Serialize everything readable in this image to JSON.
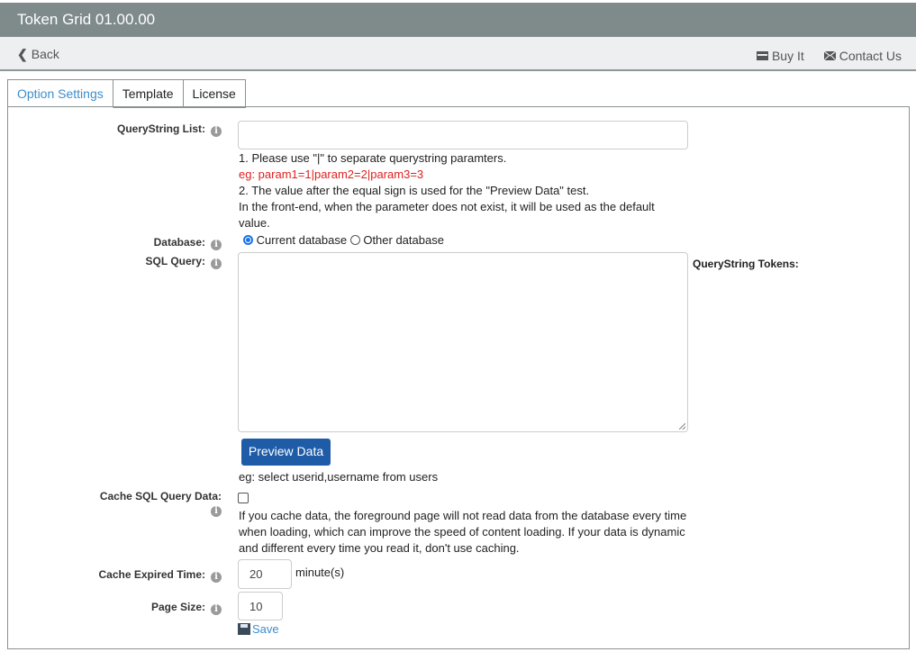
{
  "app": {
    "title": "Token Grid 01.00.00"
  },
  "nav": {
    "back_label": "Back",
    "buy_label": "Buy It",
    "contact_label": "Contact Us"
  },
  "tabs": [
    {
      "label": "Option Settings",
      "active": true
    },
    {
      "label": "Template",
      "active": false
    },
    {
      "label": "License",
      "active": false
    }
  ],
  "form": {
    "querystring": {
      "label": "QueryString List:",
      "value": "",
      "help1": "1. Please use \"|\" to separate querystring paramters.",
      "example": "eg: param1=1|param2=2|param3=3",
      "help2": "2. The value after the equal sign is used for the \"Preview Data\" test.",
      "help3": "In the front-end, when the parameter does not exist, it will be used as the default",
      "help4": "value."
    },
    "database": {
      "label": "Database:",
      "options": [
        "Current database",
        "Other database"
      ],
      "selected": "Current database"
    },
    "sql": {
      "label": "SQL Query:",
      "value": "",
      "tokens_label": "QueryString Tokens:",
      "preview_button": "Preview Data",
      "example": "eg: select userid,username from users"
    },
    "cache": {
      "label": "Cache SQL Query Data:",
      "checked": false,
      "help1": "If you cache data, the foreground page will not read data from the database every time",
      "help2": "when loading, which can improve the speed of content loading. If your data is dynamic",
      "help3": "and different every time you read it, don't use caching."
    },
    "expire": {
      "label": "Cache Expired Time:",
      "value": "20",
      "unit": "minute(s)"
    },
    "pagesize": {
      "label": "Page Size:",
      "value": "10"
    },
    "save_label": "Save"
  },
  "icons": {
    "info": "i"
  }
}
